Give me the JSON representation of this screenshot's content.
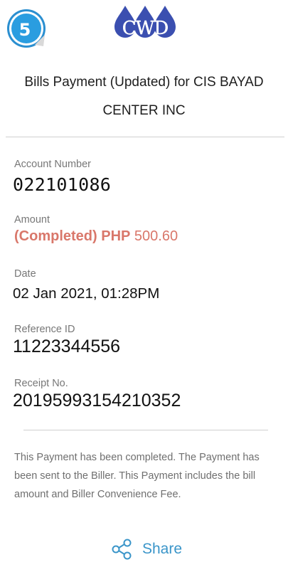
{
  "badge": {
    "number": "5"
  },
  "logo": {
    "text": "CWD"
  },
  "header": {
    "title_line1": "Bills Payment (Updated) for CIS BAYAD",
    "title_line2": "CENTER INC"
  },
  "fields": {
    "account": {
      "label": "Account Number",
      "value": "022101086"
    },
    "amount": {
      "label": "Amount",
      "status": "(Completed)",
      "currency": "PHP",
      "value": "500.60"
    },
    "date": {
      "label": "Date",
      "value": "02 Jan 2021, 01:28PM"
    },
    "reference": {
      "label": "Reference ID",
      "value": "11223344556"
    },
    "receipt": {
      "label": "Receipt No.",
      "value": "20195993154210352"
    }
  },
  "note": "This Payment has been completed. The Payment has been sent to the Biller. This Payment includes the bill amount and Biller Convenience Fee.",
  "share": {
    "label": "Share"
  },
  "colors": {
    "accent": "#3a95c9",
    "amount": "#d9776a",
    "logo": "#3b4fb0"
  }
}
